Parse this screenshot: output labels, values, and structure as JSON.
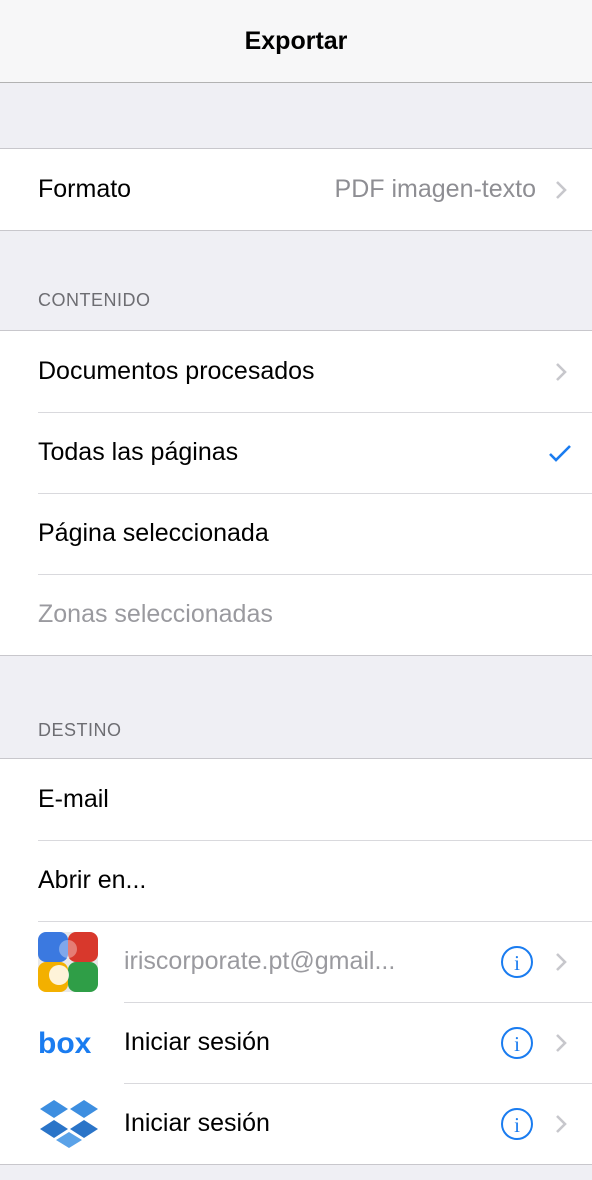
{
  "navbar": {
    "title": "Exportar"
  },
  "format": {
    "label": "Formato",
    "value": "PDF imagen-texto"
  },
  "content": {
    "header": "CONTENIDO",
    "items": [
      {
        "label": "Documentos procesados",
        "accessory": "chevron"
      },
      {
        "label": "Todas las páginas",
        "accessory": "checkmark",
        "selected": true
      },
      {
        "label": "Página seleccionada",
        "accessory": "none"
      },
      {
        "label": "Zonas seleccionadas",
        "accessory": "none",
        "disabled": true
      }
    ]
  },
  "destination": {
    "header": "DESTINO",
    "items": [
      {
        "label": "E-mail"
      },
      {
        "label": "Abrir en..."
      }
    ],
    "services": [
      {
        "icon": "google-drive-icon",
        "label": "iriscorporate.pt@gmail..."
      },
      {
        "icon": "box-logo-icon",
        "label": "Iniciar sesión"
      },
      {
        "icon": "dropbox-icon",
        "label": "Iniciar sesión"
      }
    ]
  },
  "colors": {
    "accent": "#1a7cf0",
    "chevron": "#c7c7cc",
    "background": "#efeff4"
  }
}
